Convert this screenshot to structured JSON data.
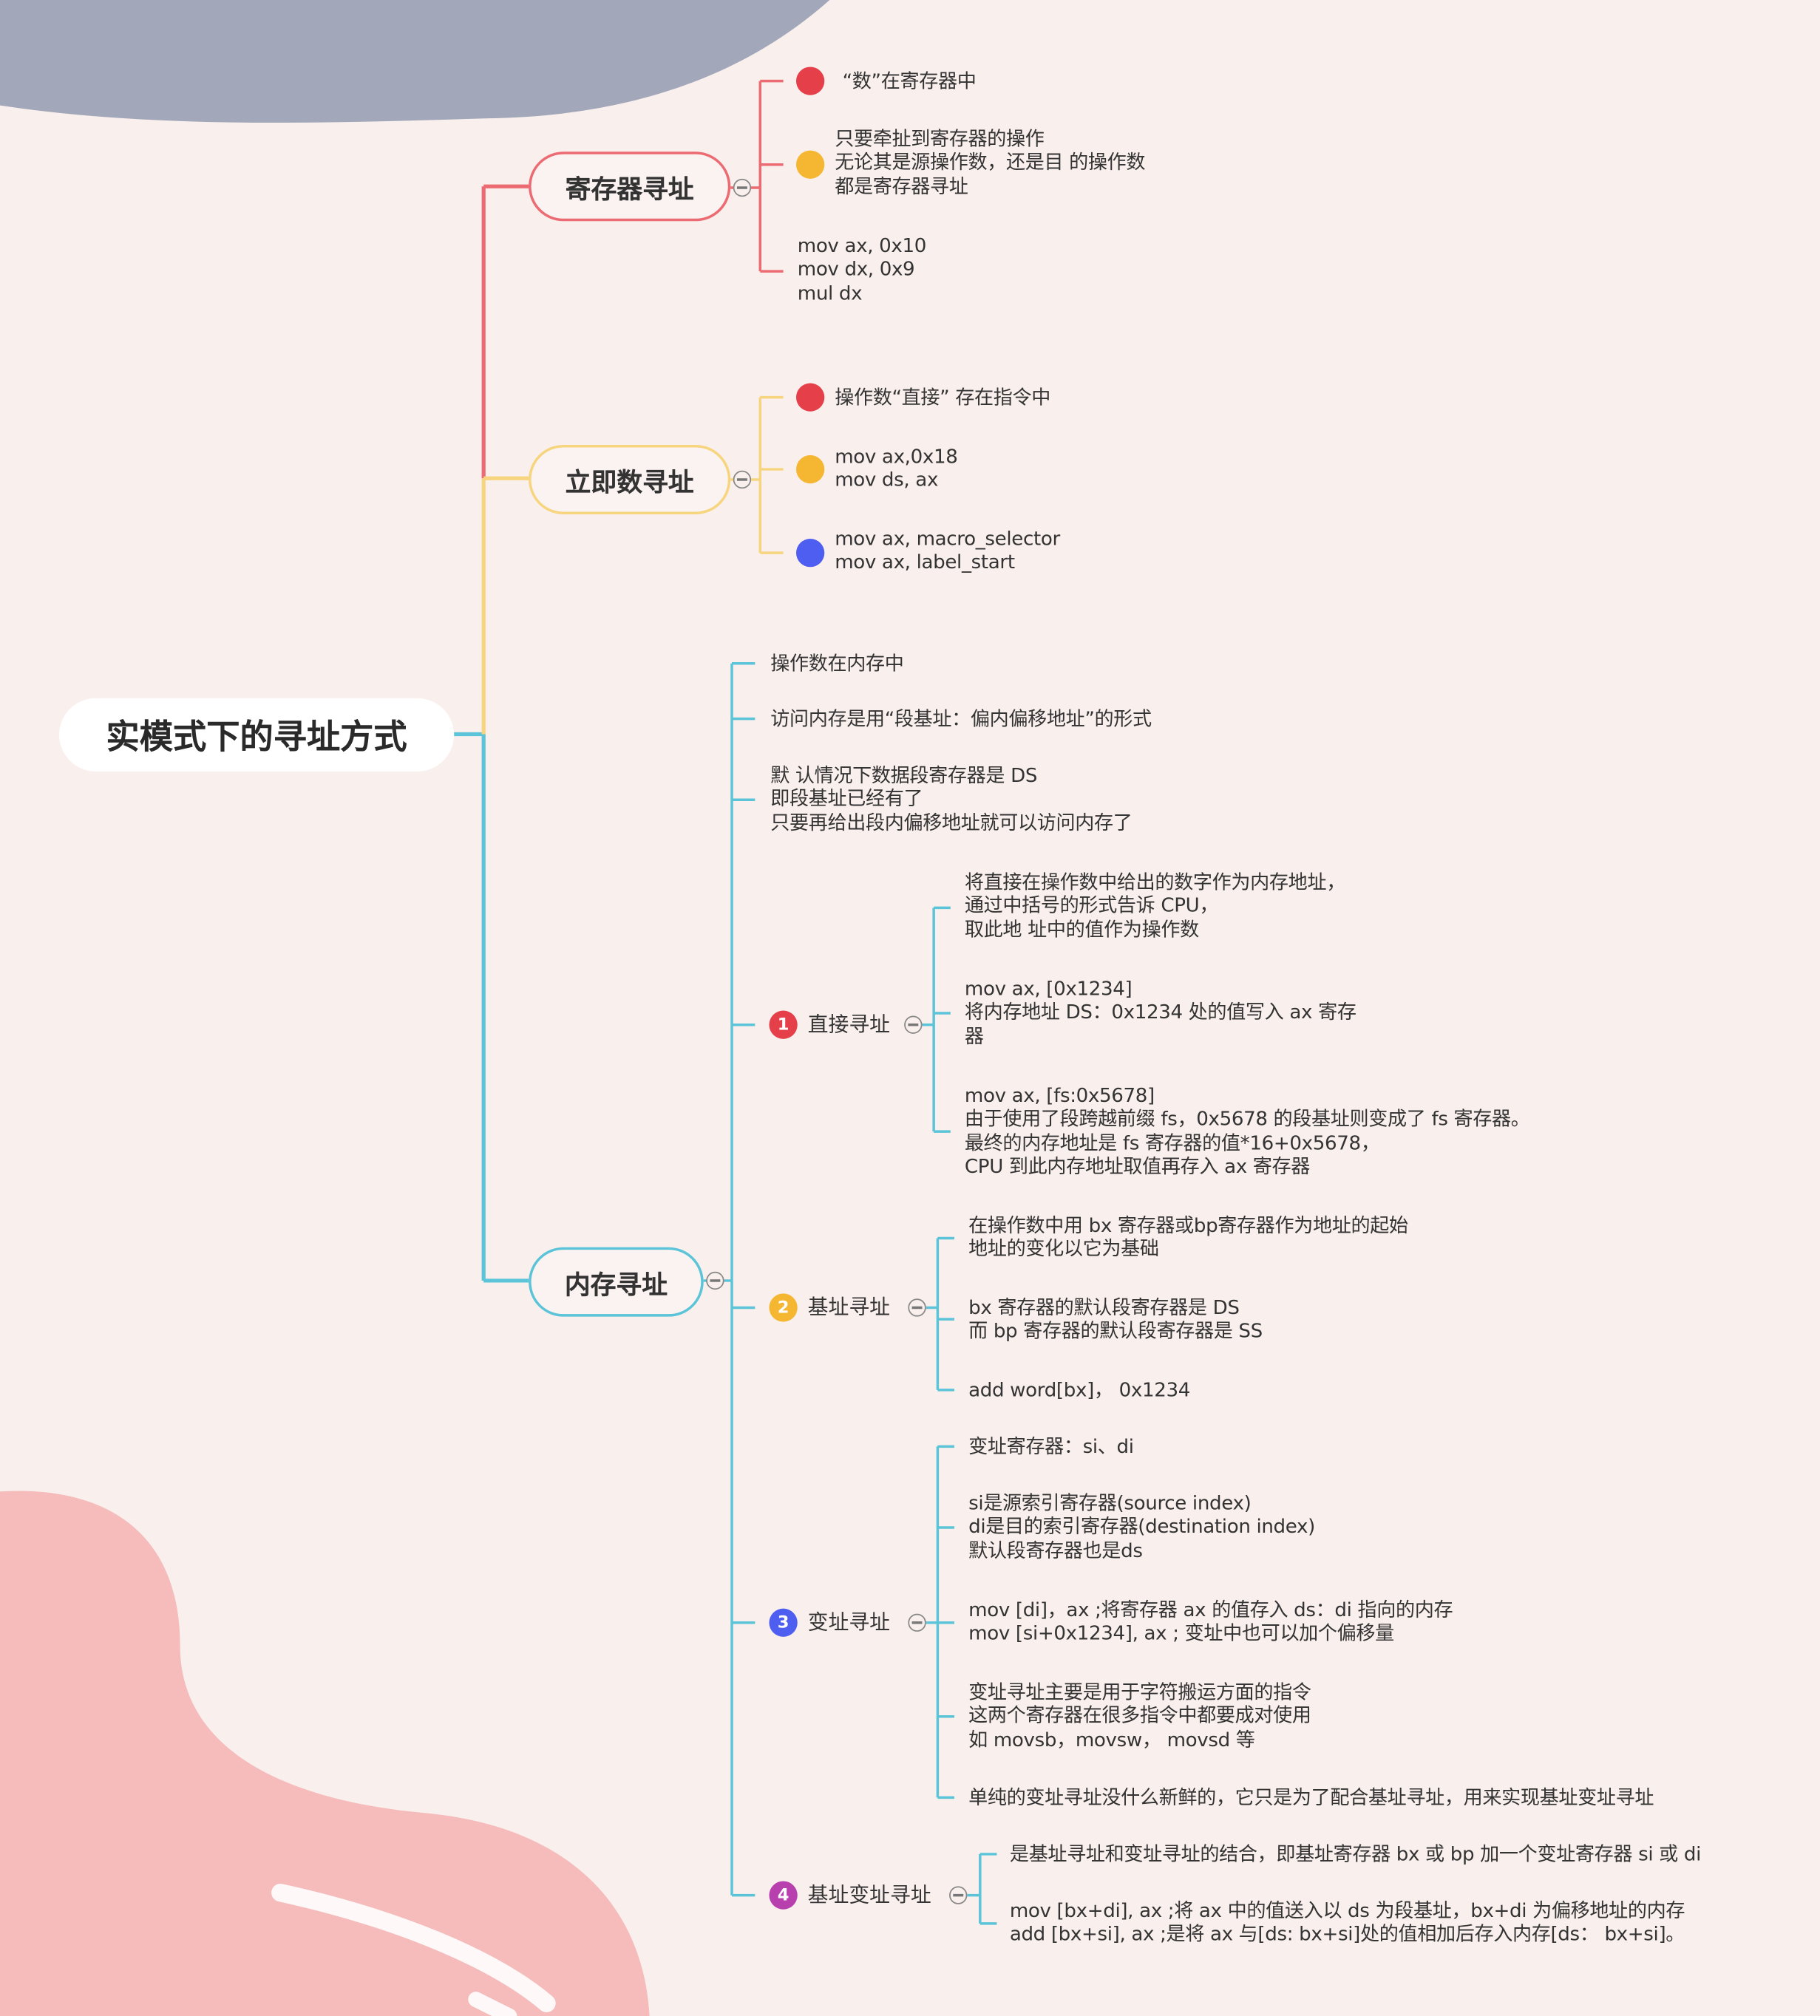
{
  "root": {
    "title": "实模式下的寻址方式"
  },
  "colors": {
    "background": "#f9efed",
    "register": "#ec6b72",
    "immediate": "#f7d57f",
    "memory": "#5bc4d8",
    "badge_1": "#e5404a",
    "badge_2": "#f5b731",
    "badge_3": "#4e5ef0",
    "badge_4": "#b83fae",
    "blob_top": "#a2a8ba",
    "blob_bottom": "#f5bcbb"
  },
  "branches": [
    {
      "title": "寄存器寻址",
      "collapse_icon": "minus-circle-icon",
      "items": [
        {
          "badge": "1",
          "text": "“数”在寄存器中"
        },
        {
          "badge": "2",
          "text": "只要牵扯到寄存器的操作\n无论其是源操作数，还是目 的操作数\n都是寄存器寻址"
        },
        {
          "badge": "",
          "text": "mov ax, 0x10\nmov dx, 0x9\nmul dx"
        }
      ]
    },
    {
      "title": "立即数寻址",
      "collapse_icon": "minus-circle-icon",
      "items": [
        {
          "badge": "1",
          "text": "操作数“直接” 存在指令中"
        },
        {
          "badge": "2",
          "text": "mov ax,0x18\nmov ds, ax"
        },
        {
          "badge": "3",
          "text": "mov ax, macro_selector\nmov ax, label_start"
        }
      ]
    },
    {
      "title": "内存寻址",
      "collapse_icon": "minus-circle-icon",
      "items": [
        {
          "text": "操作数在内存中"
        },
        {
          "text": "访问内存是用“段基址：偏内偏移地址”的形式"
        },
        {
          "text": "默 认情况下数据段寄存器是 DS\n即段基址已经有了\n只要再给出段内偏移地址就可以访问内存了"
        }
      ],
      "subtopics": [
        {
          "badge": "1",
          "label": "直接寻址",
          "items": [
            "将直接在操作数中给出的数字作为内存地址，\n通过中括号的形式告诉 CPU，\n取此地 址中的值作为操作数",
            "mov ax, [0x1234]\n将内存地址 DS：0x1234 处的值写入 ax 寄存\n器",
            "mov ax, [fs:0x5678]\n由于使用了段跨越前缀 fs，0x5678 的段基址则变成了 fs 寄存器。\n最终的内存地址是 fs 寄存器的值*16+0x5678，\nCPU 到此内存地址取值再存入 ax 寄存器"
          ]
        },
        {
          "badge": "2",
          "label": "基址寻址",
          "items": [
            "在操作数中用 bx 寄存器或bp寄存器作为地址的起始\n地址的变化以它为基础",
            "bx 寄存器的默认段寄存器是 DS\n而 bp 寄存器的默认段寄存器是 SS",
            "add word[bx]， 0x1234"
          ]
        },
        {
          "badge": "3",
          "label": "变址寻址",
          "items": [
            "变址寄存器：si、di",
            "si是源索引寄存器(source index)\ndi是目的索引寄存器(destination index)\n默认段寄存器也是ds",
            "mov [di]，ax ;将寄存器 ax 的值存入 ds：di 指向的内存\nmov [si+0x1234], ax ; 变址中也可以加个偏移量",
            "变址寻址主要是用于字符搬运方面的指令\n这两个寄存器在很多指令中都要成对使用\n如 movsb，movsw， movsd 等",
            "单纯的变址寻址没什么新鲜的，它只是为了配合基址寻址，用来实现基址变址寻址"
          ]
        },
        {
          "badge": "4",
          "label": "基址变址寻址",
          "items": [
            "是基址寻址和变址寻址的结合，即基址寄存器 bx 或 bp 加一个变址寄存器 si 或 di",
            "mov [bx+di], ax ;将 ax 中的值送入以 ds 为段基址，bx+di 为偏移地址的内存\nadd [bx+si], ax ;是将 ax 与[ds: bx+si]处的值相加后存入内存[ds： bx+si]。"
          ]
        }
      ]
    }
  ]
}
